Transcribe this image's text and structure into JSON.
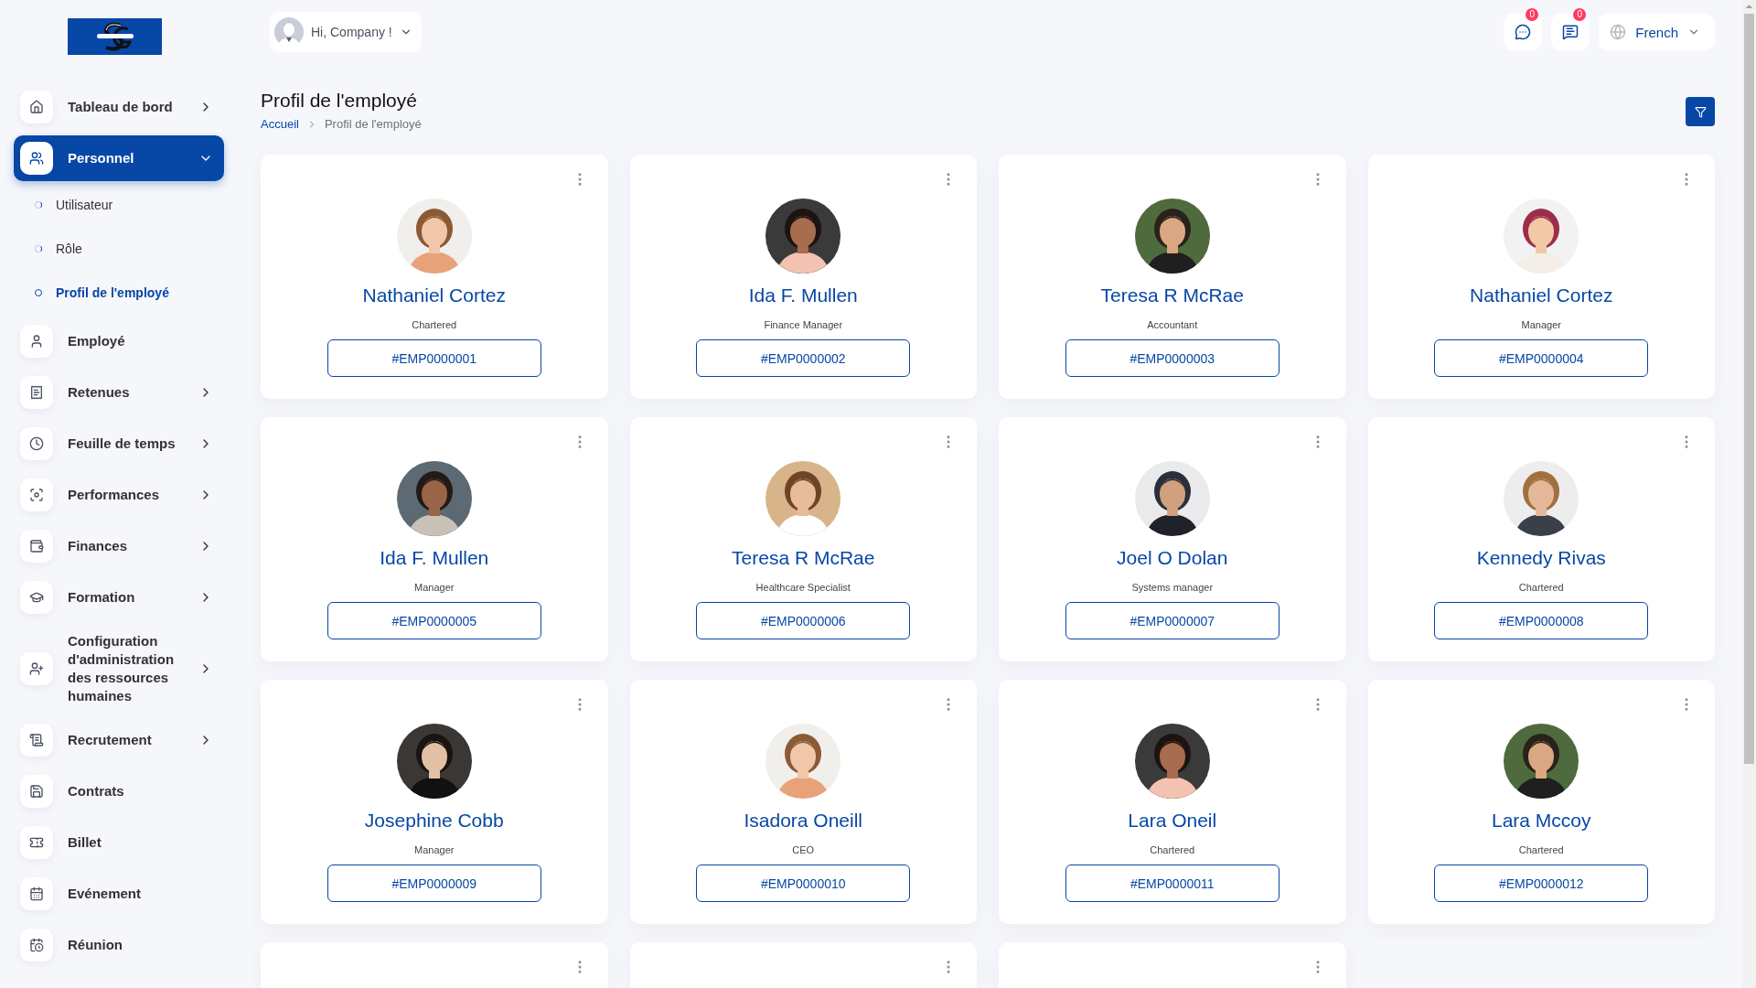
{
  "sidebar": {
    "logo": {
      "kind": "logo"
    },
    "items": [
      {
        "label": "Tableau de bord",
        "kind": "group",
        "expanded": false,
        "selected": false
      },
      {
        "label": "Personnel",
        "kind": "group",
        "expanded": true,
        "selected": true,
        "children": [
          {
            "label": "Utilisateur",
            "selected": false
          },
          {
            "label": "Rôle",
            "selected": false
          },
          {
            "label": "Profil de l'employé",
            "selected": true
          }
        ]
      },
      {
        "label": "Employé",
        "kind": "link",
        "selected": false
      },
      {
        "label": "Retenues",
        "kind": "group",
        "expanded": false,
        "selected": false
      },
      {
        "label": "Feuille de temps",
        "kind": "group",
        "expanded": false,
        "selected": false
      },
      {
        "label": "Performances",
        "kind": "group",
        "expanded": false,
        "selected": false
      },
      {
        "label": "Finances",
        "kind": "group",
        "expanded": false,
        "selected": false
      },
      {
        "label": "Formation",
        "kind": "group",
        "expanded": false,
        "selected": false
      },
      {
        "label": "Configuration d'administration des ressources humaines",
        "kind": "group",
        "expanded": false,
        "selected": false
      },
      {
        "label": "Recrutement",
        "kind": "group",
        "expanded": false,
        "selected": false
      },
      {
        "label": "Contrats",
        "kind": "link",
        "selected": false
      },
      {
        "label": "Billet",
        "kind": "link",
        "selected": false
      },
      {
        "label": "Evénement",
        "kind": "link",
        "selected": false
      },
      {
        "label": "Réunion",
        "kind": "link",
        "selected": false
      }
    ]
  },
  "header": {
    "user_menu": {
      "label": "Hi, Company !"
    },
    "notifications": [
      {
        "count": "0"
      },
      {
        "count": "0"
      }
    ],
    "language": {
      "label": "French"
    }
  },
  "page": {
    "title": "Profil de l'employé",
    "breadcrumb": [
      {
        "label": "Accueil",
        "kind": "link"
      },
      {
        "label": "Profil de l'employé",
        "kind": "current"
      }
    ]
  },
  "cards": [
    {
      "kind": "full",
      "name": "Nathaniel Cortez",
      "role": "Chartered",
      "id": "#EMP0000001"
    },
    {
      "kind": "full",
      "name": "Ida F. Mullen",
      "role": "Finance Manager",
      "id": "#EMP0000002"
    },
    {
      "kind": "full",
      "name": "Teresa R McRae",
      "role": "Accountant",
      "id": "#EMP0000003"
    },
    {
      "kind": "full",
      "name": "Nathaniel Cortez",
      "role": "Manager",
      "id": "#EMP0000004"
    },
    {
      "kind": "full",
      "name": "Ida F. Mullen",
      "role": "Manager",
      "id": "#EMP0000005"
    },
    {
      "kind": "full",
      "name": "Teresa R McRae",
      "role": "Healthcare Specialist",
      "id": "#EMP0000006"
    },
    {
      "kind": "full",
      "name": "Joel O Dolan",
      "role": "Systems manager",
      "id": "#EMP0000007"
    },
    {
      "kind": "full",
      "name": "Kennedy Rivas",
      "role": "Chartered",
      "id": "#EMP0000008"
    },
    {
      "kind": "full",
      "name": "Josephine Cobb",
      "role": "Manager",
      "id": "#EMP0000009"
    },
    {
      "kind": "full",
      "name": "Isadora Oneill",
      "role": "CEO",
      "id": "#EMP0000010"
    },
    {
      "kind": "full",
      "name": "Lara Oneil",
      "role": "Chartered",
      "id": "#EMP0000011"
    },
    {
      "kind": "full",
      "name": "Lara Mccoy",
      "role": "Chartered",
      "id": "#EMP0000012"
    },
    {
      "kind": "cut"
    },
    {
      "kind": "cut"
    },
    {
      "kind": "cut"
    }
  ]
}
